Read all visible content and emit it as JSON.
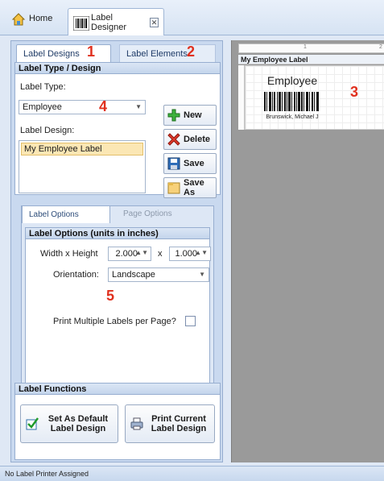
{
  "header": {
    "home_label": "Home",
    "designer_label": "Label Designer",
    "close_symbol": "✕"
  },
  "left": {
    "tabs": [
      "Label Designs",
      "Label Elements"
    ],
    "type_design_group": {
      "title": "Label Type / Design",
      "label_type_label": "Label Type:",
      "label_type_value": "Employee",
      "label_design_label": "Label Design:",
      "design_items": [
        "My Employee Label"
      ]
    },
    "buttons": {
      "new": "New",
      "delete": "Delete",
      "save": "Save",
      "save_as": "Save As"
    },
    "options_tabs": [
      "Label Options",
      "Page Options"
    ],
    "options_group": {
      "title": "Label Options (units in inches)",
      "wh_label": "Width x Height",
      "width": "2.000",
      "x_label": "x",
      "height": "1.000",
      "orientation_label": "Orientation:",
      "orientation_value": "Landscape",
      "multiple_label": "Print Multiple Labels per Page?"
    },
    "functions_group": {
      "title": "Label Functions",
      "set_default": "Set As Default Label Design",
      "print_current": "Print Current Label Design"
    }
  },
  "status": {
    "text": "No Label Printer Assigned"
  },
  "preview": {
    "title": "My Employee Label",
    "ruler_marks": [
      "1",
      "2"
    ],
    "card_title": "Employee",
    "card_name": "Brunswick, Michael J"
  },
  "annotations": [
    "1",
    "2",
    "3",
    "4",
    "5"
  ],
  "colors": {
    "annotation": "#e0301e",
    "selection": "#fbe7b4",
    "pane_bg": "#c9d9ef",
    "preview_bg": "#9a9a9a"
  },
  "icons": [
    "home-icon",
    "barcode-icon",
    "close-icon",
    "plus-icon",
    "delete-x-icon",
    "save-disk-icon",
    "save-as-folder-icon",
    "checkmark-icon",
    "printer-icon"
  ]
}
